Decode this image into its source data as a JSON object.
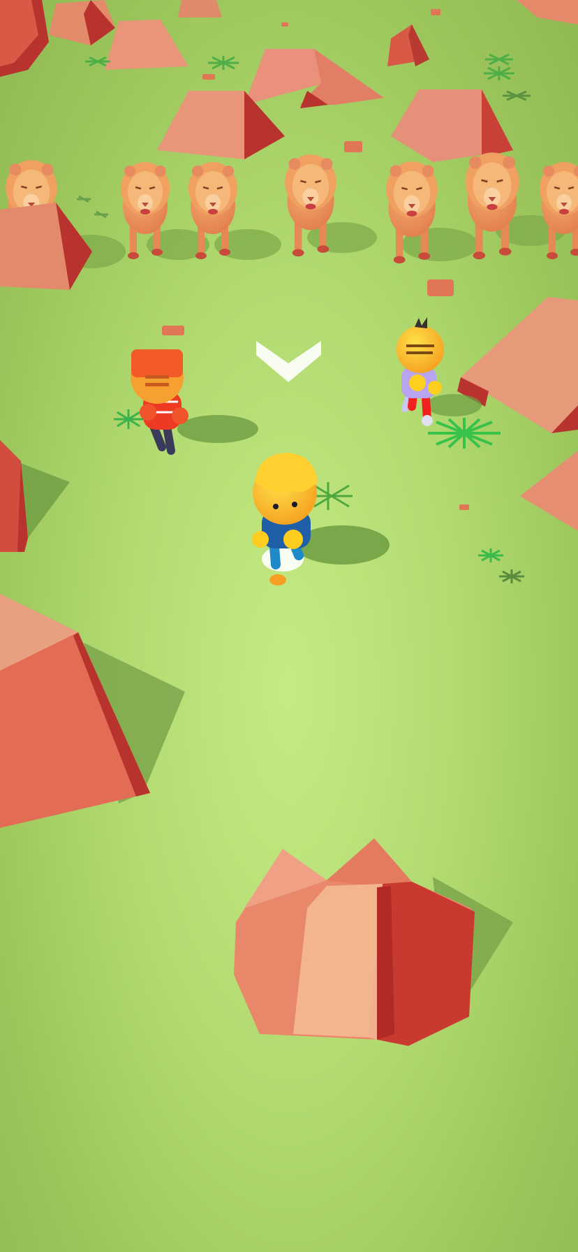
{
  "game": {
    "scene": "savanna-chase",
    "objects": {
      "player": "player-runner",
      "rivals": [
        "rival-runner-red",
        "rival-runner-purple"
      ],
      "chasers": [
        "lion",
        "lion",
        "lion",
        "lion",
        "lion",
        "lion",
        "lion"
      ],
      "direction_indicator": "chevron-down-icon"
    },
    "colors": {
      "ground": "#b8de76",
      "rock_light": "#e48a6a",
      "rock_dark": "#b8332e",
      "lion": "#e8935a",
      "grass_tuft": "#4fbf4a",
      "arrow": "#ffffff"
    }
  }
}
